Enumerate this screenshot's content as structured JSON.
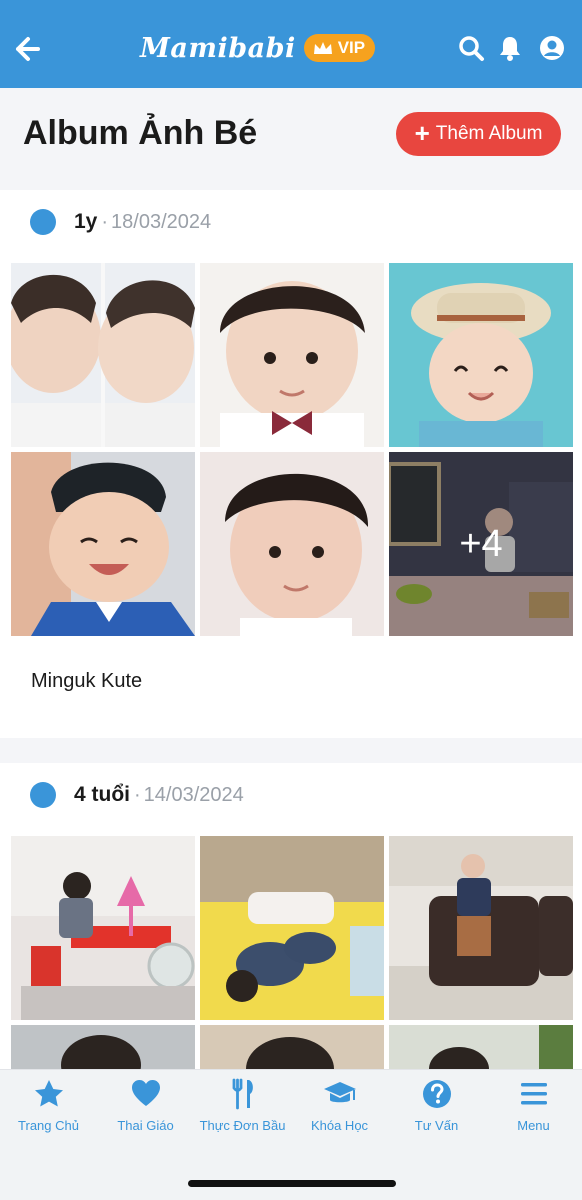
{
  "topbar": {
    "brand": "Mamibabi",
    "vip_label": "VIP"
  },
  "header": {
    "title": "Album Ảnh Bé",
    "add_button": "Thêm Album",
    "add_icon": "plus-icon"
  },
  "albums": [
    {
      "age": "1y",
      "separator": "·",
      "date": "18/03/2024",
      "name": "Minguk Kute",
      "more_count": "+4"
    },
    {
      "age": "4 tuổi",
      "separator": "·",
      "date": "14/03/2024"
    }
  ],
  "nav": {
    "items": [
      {
        "label": "Trang Chủ",
        "icon": "star-icon"
      },
      {
        "label": "Thai Giáo",
        "icon": "heart-icon"
      },
      {
        "label": "Thực Đơn Bầu",
        "icon": "fork-knife-icon"
      },
      {
        "label": "Khóa Học",
        "icon": "graduation-cap-icon"
      },
      {
        "label": "Tư Vấn",
        "icon": "question-icon"
      },
      {
        "label": "Menu",
        "icon": "hamburger-icon"
      }
    ]
  },
  "colors": {
    "primary": "#3a95d9",
    "accent_red": "#e8463f",
    "vip_orange": "#f6a21e"
  }
}
